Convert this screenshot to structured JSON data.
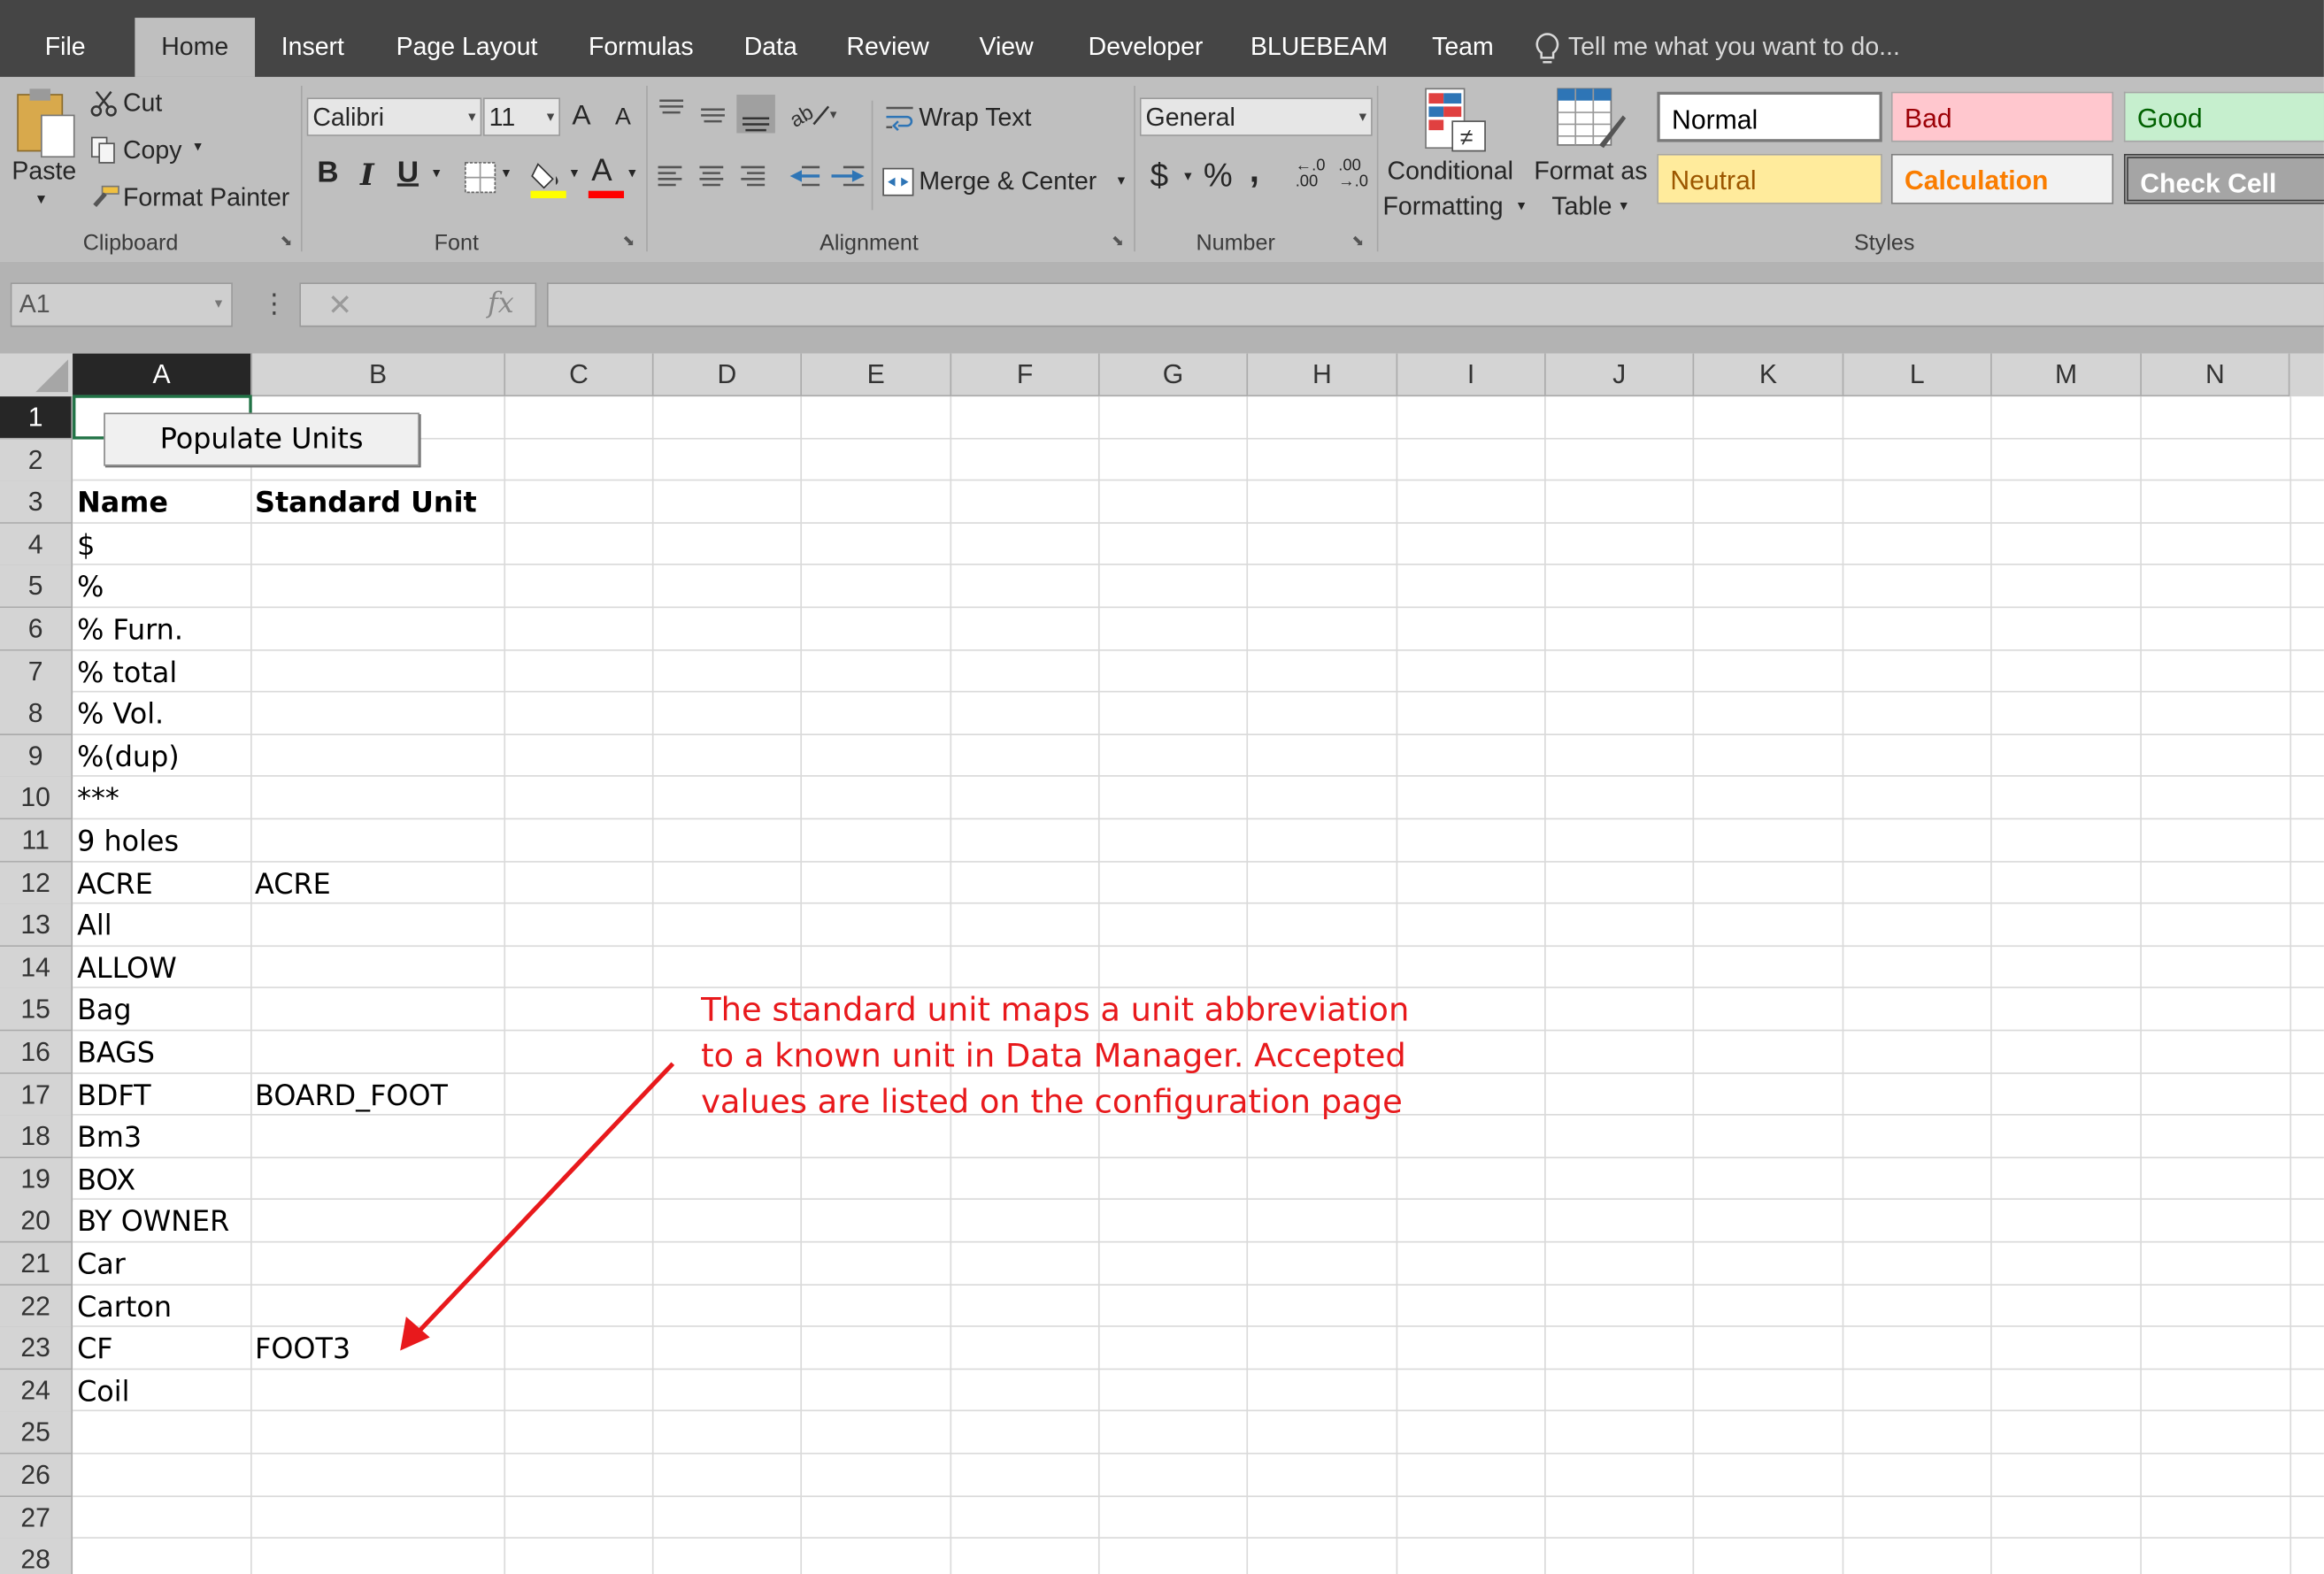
{
  "tabs": [
    {
      "label": "File",
      "active": false
    },
    {
      "label": "Home",
      "active": true
    },
    {
      "label": "Insert",
      "active": false
    },
    {
      "label": "Page Layout",
      "active": false
    },
    {
      "label": "Formulas",
      "active": false
    },
    {
      "label": "Data",
      "active": false
    },
    {
      "label": "Review",
      "active": false
    },
    {
      "label": "View",
      "active": false
    },
    {
      "label": "Developer",
      "active": false
    },
    {
      "label": "BLUEBEAM",
      "active": false
    },
    {
      "label": "Team",
      "active": false
    }
  ],
  "tell_me": "Tell me what you want to do...",
  "clipboard": {
    "paste": "Paste",
    "cut": "Cut",
    "copy": "Copy",
    "format_painter": "Format Painter",
    "group": "Clipboard"
  },
  "font": {
    "name": "Calibri",
    "size": "11",
    "grow": "A",
    "shrink": "A",
    "bold": "B",
    "italic": "I",
    "underline": "U",
    "font_color_glyph": "A",
    "group": "Font"
  },
  "alignment": {
    "wrap_text": "Wrap Text",
    "merge_center": "Merge & Center",
    "group": "Alignment"
  },
  "number": {
    "format": "General",
    "currency": "$",
    "percent": "%",
    "comma": ",",
    "increase_decimal_top": "←.0",
    "increase_decimal_bottom": ".00",
    "decrease_decimal_top": ".00",
    "decrease_decimal_bottom": "→.0",
    "group": "Number"
  },
  "styles": {
    "conditional_formatting_1": "Conditional",
    "conditional_formatting_2": "Formatting",
    "format_as_table_1": "Format as",
    "format_as_table_2": "Table",
    "cells": [
      {
        "label": "Normal",
        "bg": "#ffffff",
        "color": "#000000"
      },
      {
        "label": "Bad",
        "bg": "#ffc7ce",
        "color": "#9c0006"
      },
      {
        "label": "Good",
        "bg": "#c6efce",
        "color": "#006100"
      },
      {
        "label": "Neutral",
        "bg": "#ffeb9c",
        "color": "#9c5700"
      },
      {
        "label": "Calculation",
        "bg": "#f2f2f2",
        "color": "#fa7d00"
      },
      {
        "label": "Check Cell",
        "bg": "#a5a5a5",
        "color": "#ffffff"
      }
    ],
    "group": "Styles"
  },
  "formula_bar": {
    "name_box": "A1",
    "fx": "fx",
    "cancel": "✕",
    "value": ""
  },
  "columns": [
    "A",
    "B",
    "C",
    "D",
    "E",
    "F",
    "G",
    "H",
    "I",
    "J",
    "K",
    "L",
    "M",
    "N"
  ],
  "rows": [
    "1",
    "2",
    "3",
    "4",
    "5",
    "6",
    "7",
    "8",
    "9",
    "10",
    "11",
    "12",
    "13",
    "14",
    "15",
    "16",
    "17",
    "18",
    "19",
    "20",
    "21",
    "22",
    "23",
    "24",
    "25",
    "26",
    "27",
    "28"
  ],
  "button": "Populate Units",
  "header": {
    "name": "Name",
    "standard_unit": "Standard Unit"
  },
  "data_rows": [
    {
      "name": "$",
      "unit": ""
    },
    {
      "name": "%",
      "unit": ""
    },
    {
      "name": "% Furn.",
      "unit": ""
    },
    {
      "name": "% total",
      "unit": ""
    },
    {
      "name": "% Vol.",
      "unit": ""
    },
    {
      "name": "%(dup)",
      "unit": ""
    },
    {
      "name": "***",
      "unit": ""
    },
    {
      "name": "9 holes",
      "unit": ""
    },
    {
      "name": "ACRE",
      "unit": "ACRE"
    },
    {
      "name": "All",
      "unit": ""
    },
    {
      "name": "ALLOW",
      "unit": ""
    },
    {
      "name": "Bag",
      "unit": ""
    },
    {
      "name": "BAGS",
      "unit": ""
    },
    {
      "name": "BDFT",
      "unit": "BOARD_FOOT"
    },
    {
      "name": "Bm3",
      "unit": ""
    },
    {
      "name": "BOX",
      "unit": ""
    },
    {
      "name": "BY OWNER",
      "unit": ""
    },
    {
      "name": "Car",
      "unit": ""
    },
    {
      "name": "Carton",
      "unit": ""
    },
    {
      "name": "CF",
      "unit": "FOOT3"
    },
    {
      "name": "Coil",
      "unit": ""
    }
  ],
  "annotation": {
    "line1": "The standard unit maps a unit abbreviation",
    "line2": "to a known unit in Data Manager.  Accepted",
    "line3": "values are listed on the configuration page",
    "color": "#e8191c"
  }
}
